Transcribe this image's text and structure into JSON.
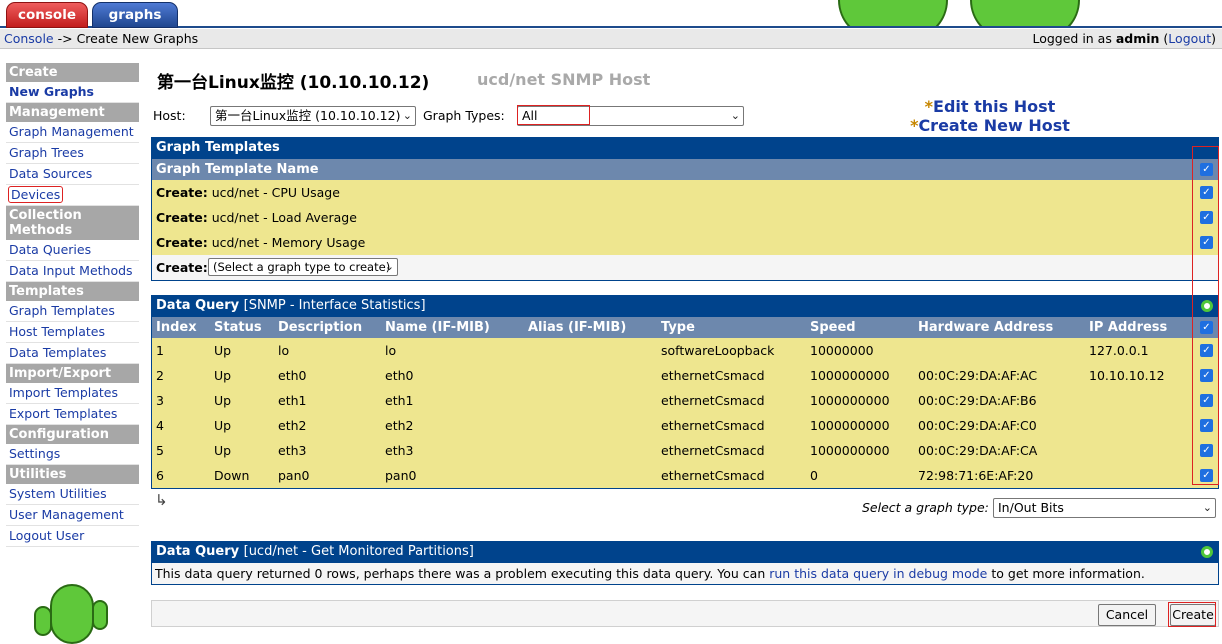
{
  "tabs": {
    "console": "console",
    "graphs": "graphs"
  },
  "breadcrumb": {
    "console": "Console",
    "arrow": "->",
    "current": "Create New Graphs",
    "logged_in_prefix": "Logged in as",
    "user": "admin",
    "logout": "Logout"
  },
  "sidebar": {
    "sections": [
      {
        "header": "Create",
        "items": [
          "New Graphs"
        ]
      },
      {
        "header": "Management",
        "items": [
          "Graph Management",
          "Graph Trees",
          "Data Sources",
          "Devices"
        ]
      },
      {
        "header": "Collection Methods",
        "items": [
          "Data Queries",
          "Data Input Methods"
        ]
      },
      {
        "header": "Templates",
        "items": [
          "Graph Templates",
          "Host Templates",
          "Data Templates"
        ]
      },
      {
        "header": "Import/Export",
        "items": [
          "Import Templates",
          "Export Templates"
        ]
      },
      {
        "header": "Configuration",
        "items": [
          "Settings"
        ]
      },
      {
        "header": "Utilities",
        "items": [
          "System Utilities",
          "User Management",
          "Logout User"
        ]
      }
    ]
  },
  "page": {
    "title": "第一台Linux监控 (10.10.10.12)",
    "subtitle": "ucd/net SNMP Host"
  },
  "host_row": {
    "host_label": "Host:",
    "host_value": "第一台Linux监控 (10.10.10.12)",
    "types_label": "Graph Types:",
    "types_value": "All"
  },
  "links": {
    "star": "*",
    "edit_host": "Edit this Host",
    "create_host": "Create New Host"
  },
  "graph_templates": {
    "title": "Graph Templates",
    "column": "Graph Template Name",
    "create_label": "Create:",
    "rows": [
      "ucd/net - CPU Usage",
      "ucd/net - Load Average",
      "ucd/net - Memory Usage"
    ],
    "select_placeholder": "(Select a graph type to create)"
  },
  "query1": {
    "title": "Data Query",
    "name": "[SNMP - Interface Statistics]",
    "columns": [
      "Index",
      "Status",
      "Description",
      "Name (IF-MIB)",
      "Alias (IF-MIB)",
      "Type",
      "Speed",
      "Hardware Address",
      "IP Address"
    ],
    "rows": [
      [
        "1",
        "Up",
        "lo",
        "lo",
        "",
        "softwareLoopback",
        "10000000",
        "",
        "127.0.0.1"
      ],
      [
        "2",
        "Up",
        "eth0",
        "eth0",
        "",
        "ethernetCsmacd",
        "1000000000",
        "00:0C:29:DA:AF:AC",
        "10.10.10.12"
      ],
      [
        "3",
        "Up",
        "eth1",
        "eth1",
        "",
        "ethernetCsmacd",
        "1000000000",
        "00:0C:29:DA:AF:B6",
        ""
      ],
      [
        "4",
        "Up",
        "eth2",
        "eth2",
        "",
        "ethernetCsmacd",
        "1000000000",
        "00:0C:29:DA:AF:C0",
        ""
      ],
      [
        "5",
        "Up",
        "eth3",
        "eth3",
        "",
        "ethernetCsmacd",
        "1000000000",
        "00:0C:29:DA:AF:CA",
        ""
      ],
      [
        "6",
        "Down",
        "pan0",
        "pan0",
        "",
        "ethernetCsmacd",
        "0",
        "72:98:71:6E:AF:20",
        ""
      ]
    ],
    "select_label": "Select a graph type:",
    "select_value": "In/Out Bits"
  },
  "query2": {
    "title": "Data Query",
    "name": "[ucd/net - Get Monitored Partitions]",
    "msg_before": "This data query returned 0 rows, perhaps there was a problem executing this data query. You can",
    "msg_link": "run this data query in debug mode",
    "msg_after": "to get more information."
  },
  "buttons": {
    "cancel": "Cancel",
    "create": "Create"
  },
  "icons": {
    "check": "checkbox-icon",
    "radio": "radio-icon",
    "corner": "corner-arrow-icon"
  },
  "colors": {
    "header_blue": "#00438c",
    "subheader": "#6d88ad",
    "row_yellow": "#eee68f",
    "highlight_red": "#dd2222"
  }
}
